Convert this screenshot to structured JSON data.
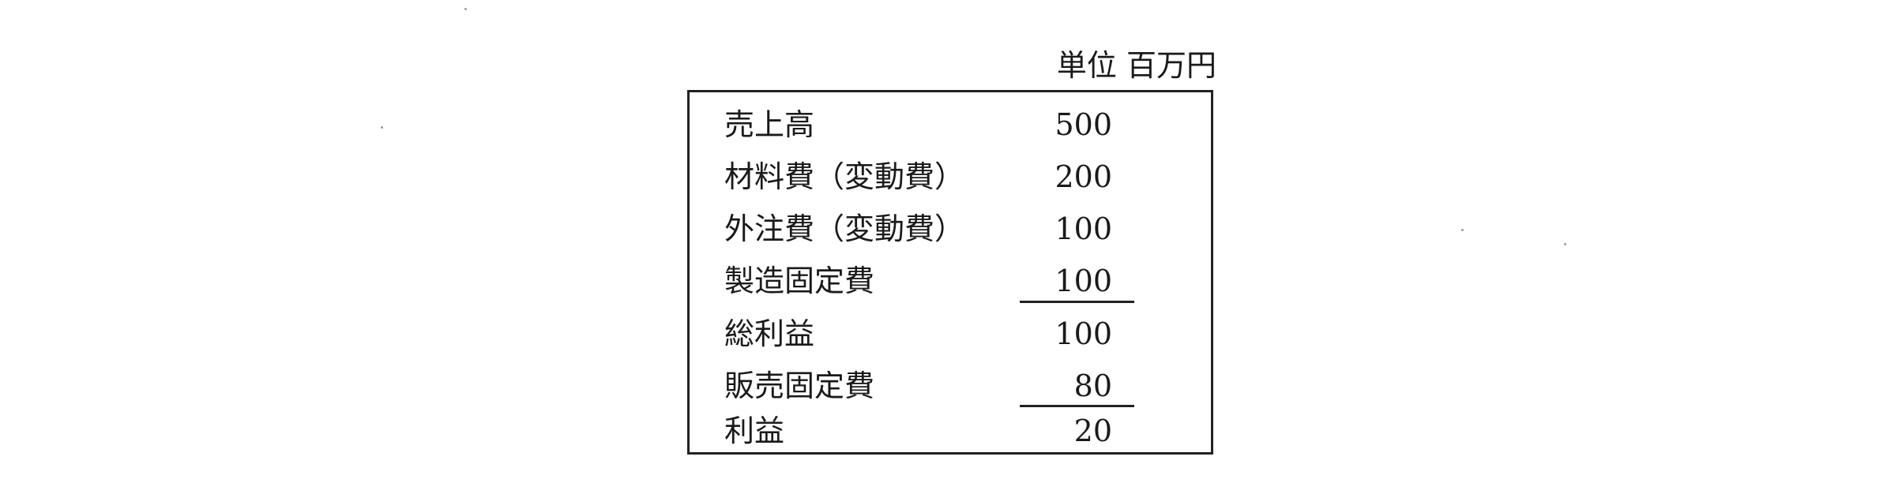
{
  "unit": "単位 百万円",
  "rows": [
    {
      "label": "売上高",
      "value": "500"
    },
    {
      "label": "材料費（変動費）",
      "value": "200"
    },
    {
      "label": "外注費（変動費）",
      "value": "100"
    },
    {
      "label": "製造固定費",
      "value": "100"
    },
    {
      "label": "総利益",
      "value": "100"
    },
    {
      "label": "販売固定費",
      "value": "80"
    },
    {
      "label": "利益",
      "value": "20"
    }
  ]
}
